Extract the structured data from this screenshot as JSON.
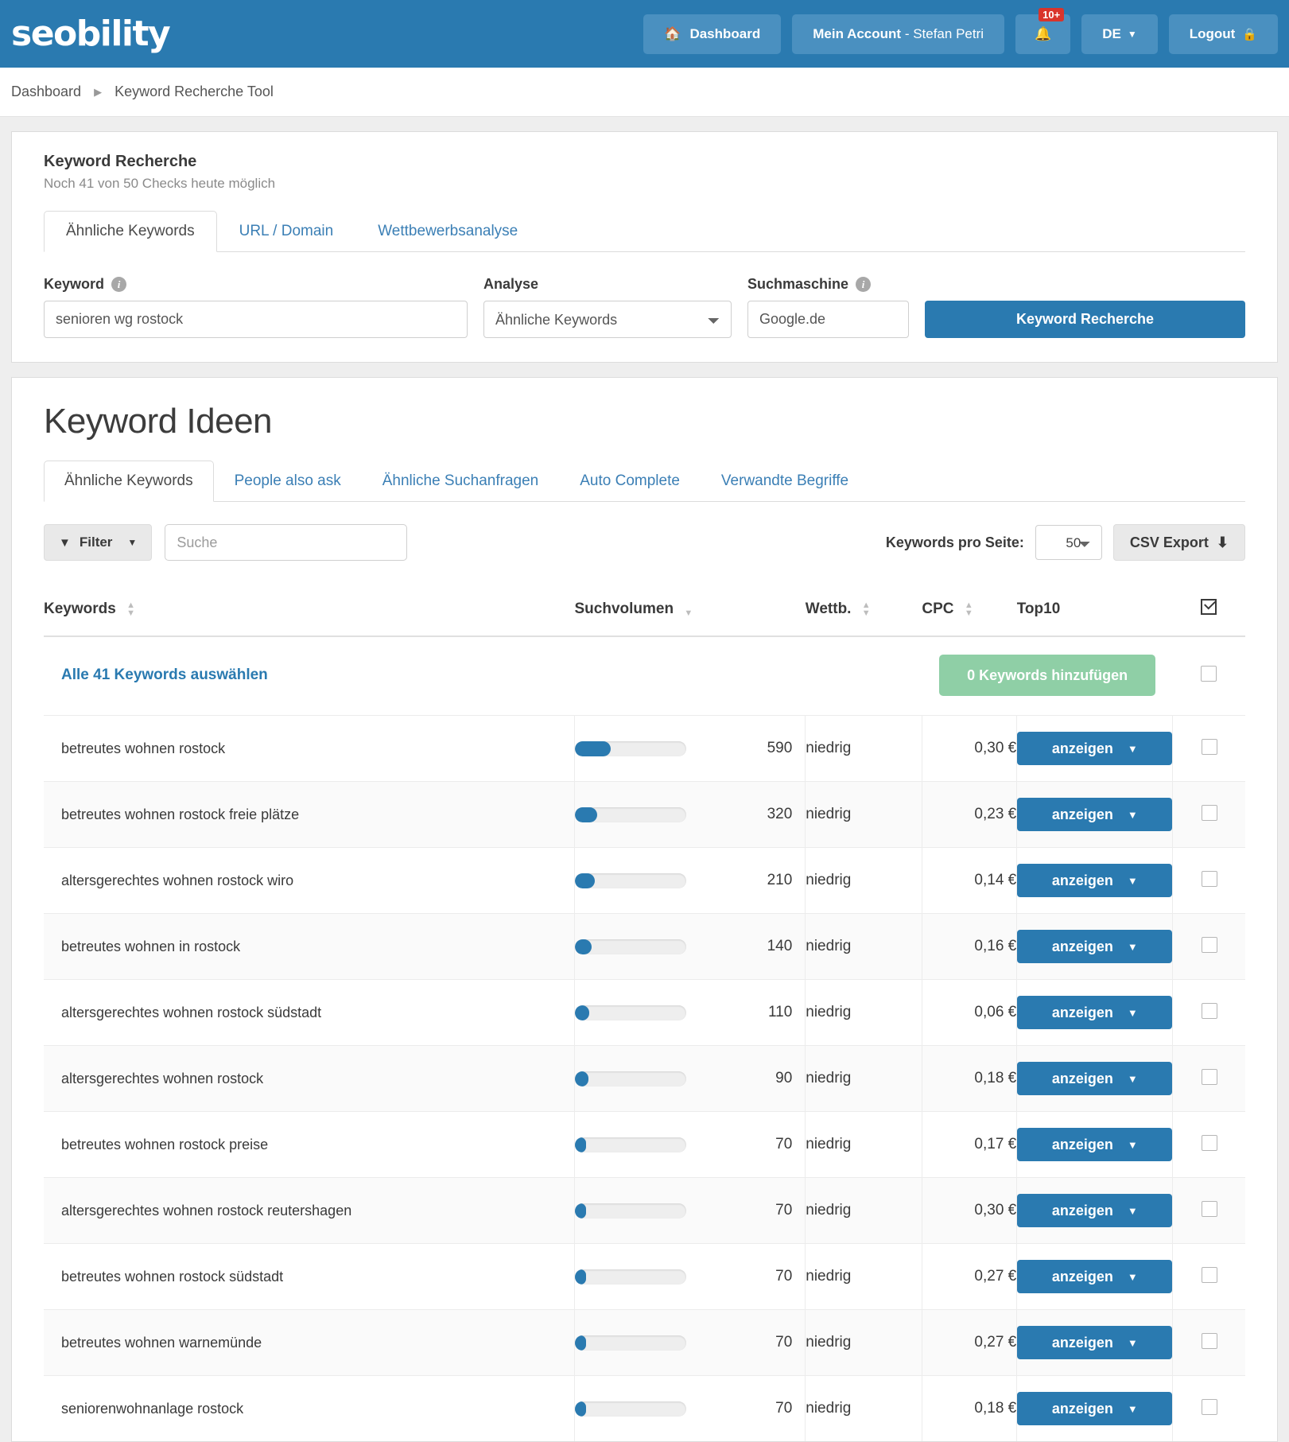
{
  "header": {
    "logo": "seobility",
    "dashboard_label": "Dashboard",
    "account_bold": "Mein Account",
    "account_name": "- Stefan Petri",
    "notifications_badge": "10+",
    "language": "DE",
    "logout_label": "Logout"
  },
  "breadcrumb": {
    "root": "Dashboard",
    "current": "Keyword Recherche Tool"
  },
  "search_panel": {
    "title": "Keyword Recherche",
    "subtitle": "Noch 41 von 50 Checks heute möglich",
    "tabs": [
      {
        "label": "Ähnliche Keywords",
        "active": true
      },
      {
        "label": "URL / Domain",
        "active": false
      },
      {
        "label": "Wettbewerbsanalyse",
        "active": false
      }
    ],
    "keyword_label": "Keyword",
    "keyword_value": "senioren wg rostock",
    "analyse_label": "Analyse",
    "analyse_value": "Ähnliche Keywords",
    "suchmaschine_label": "Suchmaschine",
    "suchmaschine_value": "Google.de",
    "submit_label": "Keyword Recherche"
  },
  "ideas": {
    "title": "Keyword Ideen",
    "tabs": [
      {
        "label": "Ähnliche Keywords",
        "active": true
      },
      {
        "label": "People also ask",
        "active": false
      },
      {
        "label": "Ähnliche Suchanfragen",
        "active": false
      },
      {
        "label": "Auto Complete",
        "active": false
      },
      {
        "label": "Verwandte Begriffe",
        "active": false
      }
    ],
    "filter_label": "Filter",
    "search_placeholder": "Suche",
    "search_value": "",
    "per_page_label": "Keywords pro Seite:",
    "per_page_value": "50",
    "csv_label": "CSV Export",
    "select_all_label": "Alle 41 Keywords auswählen",
    "add_keywords_label": "0 Keywords hinzufügen",
    "columns": {
      "keywords": "Keywords",
      "suchvolumen": "Suchvolumen",
      "wettb": "Wettb.",
      "cpc": "CPC",
      "top10": "Top10"
    },
    "show_button_label": "anzeigen",
    "rows": [
      {
        "keyword": "betreutes wohnen rostock",
        "volume": "590",
        "bar_pct": 32,
        "wettb": "niedrig",
        "cpc": "0,30 €"
      },
      {
        "keyword": "betreutes wohnen rostock freie plätze",
        "volume": "320",
        "bar_pct": 20,
        "wettb": "niedrig",
        "cpc": "0,23 €"
      },
      {
        "keyword": "altersgerechtes wohnen rostock wiro",
        "volume": "210",
        "bar_pct": 18,
        "wettb": "niedrig",
        "cpc": "0,14 €"
      },
      {
        "keyword": "betreutes wohnen in rostock",
        "volume": "140",
        "bar_pct": 15,
        "wettb": "niedrig",
        "cpc": "0,16 €"
      },
      {
        "keyword": "altersgerechtes wohnen rostock südstadt",
        "volume": "110",
        "bar_pct": 13,
        "wettb": "niedrig",
        "cpc": "0,06 €"
      },
      {
        "keyword": "altersgerechtes wohnen rostock",
        "volume": "90",
        "bar_pct": 12,
        "wettb": "niedrig",
        "cpc": "0,18 €"
      },
      {
        "keyword": "betreutes wohnen rostock preise",
        "volume": "70",
        "bar_pct": 10,
        "wettb": "niedrig",
        "cpc": "0,17 €"
      },
      {
        "keyword": "altersgerechtes wohnen rostock reutershagen",
        "volume": "70",
        "bar_pct": 10,
        "wettb": "niedrig",
        "cpc": "0,30 €"
      },
      {
        "keyword": "betreutes wohnen rostock südstadt",
        "volume": "70",
        "bar_pct": 10,
        "wettb": "niedrig",
        "cpc": "0,27 €"
      },
      {
        "keyword": "betreutes wohnen warnemünde",
        "volume": "70",
        "bar_pct": 10,
        "wettb": "niedrig",
        "cpc": "0,27 €"
      },
      {
        "keyword": "seniorenwohnanlage rostock",
        "volume": "70",
        "bar_pct": 10,
        "wettb": "niedrig",
        "cpc": "0,18 €"
      }
    ]
  },
  "colors": {
    "brand_blue": "#2a7ab0",
    "badge_red": "#d9342b",
    "add_green": "#8fcfa6"
  }
}
